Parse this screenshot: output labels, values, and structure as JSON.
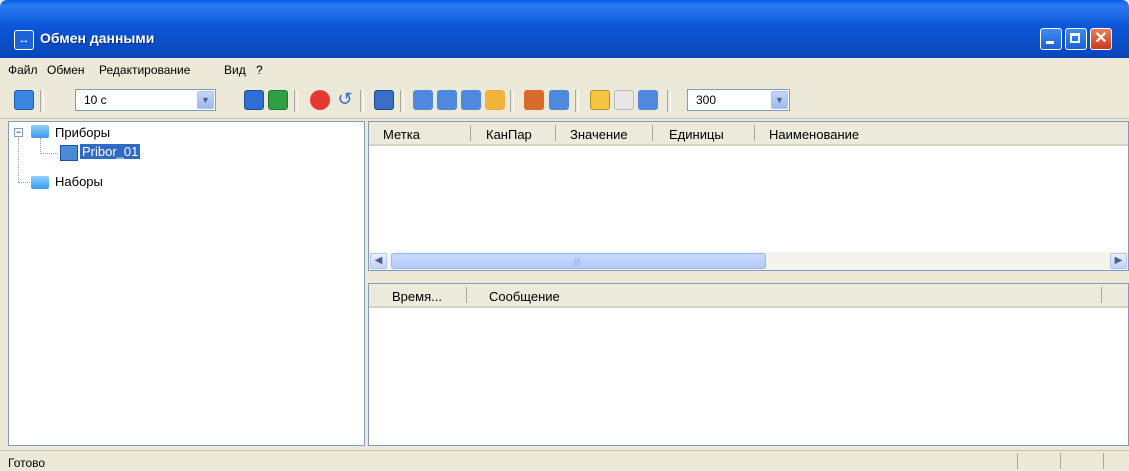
{
  "window": {
    "title": "Обмен данными"
  },
  "menu": [
    "Файл",
    "Обмен",
    "Редактирование",
    "Вид",
    "?"
  ],
  "toolbar": {
    "interval_value": "10 с",
    "count_value": "300"
  },
  "tree": {
    "root1": "Приборы",
    "device": "Pribor_01",
    "root2": "Наборы"
  },
  "top_table": {
    "columns": [
      "Метка",
      "КанПар",
      "Значение",
      "Единицы",
      "Наименование"
    ]
  },
  "bottom_table": {
    "columns": [
      "Время...",
      "Сообщение"
    ]
  },
  "status": {
    "text": "Готово"
  },
  "colors": {
    "titlebar": "#0a4fc9",
    "selection": "#316ac5"
  },
  "icons": [
    "refresh-icon",
    "back-icon",
    "forward-icon",
    "stop-icon",
    "undo-icon",
    "save-icon",
    "edit-icon",
    "delete-icon",
    "export-icon",
    "palette-icon",
    "import-icon",
    "device-icon",
    "search-icon",
    "grid-icon",
    "chart-icon"
  ]
}
